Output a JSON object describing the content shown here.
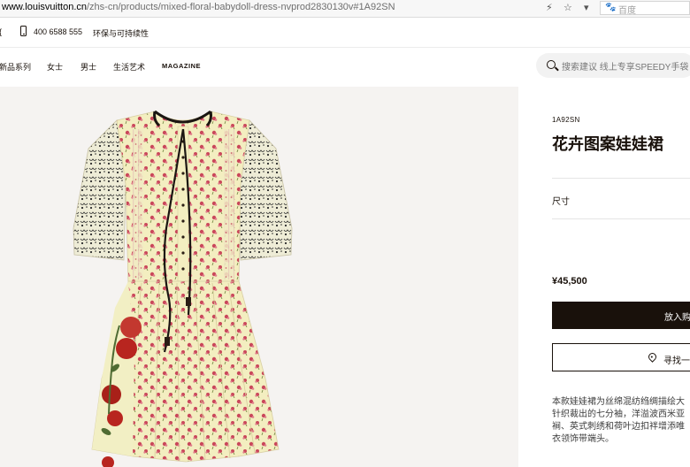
{
  "browser": {
    "url_domain": "www.louisvuitton.cn",
    "url_path": "/zhs-cn/products/mixed-floral-babydoll-dress-nvprod2830130v#1A92SN",
    "search_engine_label": "百度"
  },
  "utility_bar": {
    "left_fragment": "{",
    "phone": "400 6588 555",
    "sustainability": "环保与可持续性"
  },
  "nav": {
    "items": [
      "新品系列",
      "女士",
      "男士",
      "生活艺术",
      "MAGAZINE"
    ],
    "search_placeholder": "搜索建议  线上专享SPEEDY手袋"
  },
  "product": {
    "sku": "1A92SN",
    "title": "花卉图案娃娃裙",
    "size_label": "尺寸",
    "price": "¥45,500",
    "add_to_cart": "放入购物车",
    "find_in_store": "寻找一家店铺",
    "description_lines": [
      "本款娃娃裙为丝绵混纺绉绸描绘大",
      "针织裁出的七分袖，洋溢波西米亚",
      "裥、英式刺绣和荷叶边扣袢增添唯",
      "衣领饰带端头。"
    ]
  },
  "colors": {
    "brand_dark": "#19110b",
    "image_bg": "#f5f3f1",
    "dress_base": "#f3eec0",
    "flower_red": "#b8251f"
  },
  "icons": [
    "phone-icon",
    "search-icon",
    "location-pin-icon",
    "star-icon",
    "chevron-down-icon",
    "lightning-icon",
    "paw-icon"
  ]
}
